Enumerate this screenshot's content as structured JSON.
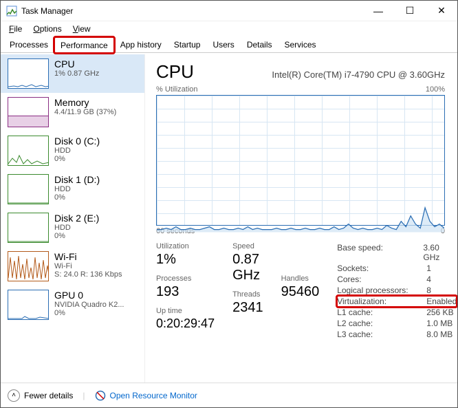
{
  "window": {
    "title": "Task Manager"
  },
  "menu": {
    "file": "File",
    "options": "Options",
    "view": "View"
  },
  "tabs": {
    "processes": "Processes",
    "performance": "Performance",
    "apphistory": "App history",
    "startup": "Startup",
    "users": "Users",
    "details": "Details",
    "services": "Services"
  },
  "sidebar": [
    {
      "title": "CPU",
      "sub1": "1%  0.87 GHz",
      "sub2": "",
      "color": "#2a6db3"
    },
    {
      "title": "Memory",
      "sub1": "4.4/11.9 GB (37%)",
      "sub2": "",
      "color": "#8a2d82"
    },
    {
      "title": "Disk 0 (C:)",
      "sub1": "HDD",
      "sub2": "0%",
      "color": "#3a8a2d"
    },
    {
      "title": "Disk 1 (D:)",
      "sub1": "HDD",
      "sub2": "0%",
      "color": "#3a8a2d"
    },
    {
      "title": "Disk 2 (E:)",
      "sub1": "HDD",
      "sub2": "0%",
      "color": "#3a8a2d"
    },
    {
      "title": "Wi-Fi",
      "sub1": "Wi-Fi",
      "sub2": "S: 24.0  R: 136 Kbps",
      "color": "#b35a1a"
    },
    {
      "title": "GPU 0",
      "sub1": "NVIDIA Quadro K2...",
      "sub2": "0%",
      "color": "#2a6db3"
    }
  ],
  "main": {
    "heading": "CPU",
    "model": "Intel(R) Core(TM) i7-4790 CPU @ 3.60GHz",
    "chart_top_left": "% Utilization",
    "chart_top_right": "100%",
    "chart_bot_left": "60 seconds",
    "chart_bot_right": "0",
    "stats": {
      "utilization_lbl": "Utilization",
      "utilization_val": "1%",
      "speed_lbl": "Speed",
      "speed_val": "0.87 GHz",
      "processes_lbl": "Processes",
      "processes_val": "193",
      "threads_lbl": "Threads",
      "threads_val": "2341",
      "handles_lbl": "Handles",
      "handles_val": "95460",
      "uptime_lbl": "Up time",
      "uptime_val": "0:20:29:47"
    },
    "right": {
      "base_speed_k": "Base speed:",
      "base_speed_v": "3.60 GHz",
      "sockets_k": "Sockets:",
      "sockets_v": "1",
      "cores_k": "Cores:",
      "cores_v": "4",
      "logical_k": "Logical processors:",
      "logical_v": "8",
      "virt_k": "Virtualization:",
      "virt_v": "Enabled",
      "l1_k": "L1 cache:",
      "l1_v": "256 KB",
      "l2_k": "L2 cache:",
      "l2_v": "1.0 MB",
      "l3_k": "L3 cache:",
      "l3_v": "8.0 MB"
    }
  },
  "footer": {
    "fewer": "Fewer details",
    "resmon": "Open Resource Monitor"
  },
  "chart_data": {
    "type": "line",
    "title": "% Utilization",
    "xlabel": "60 seconds",
    "ylabel": "",
    "ylim": [
      0,
      100
    ],
    "x": [
      0,
      1,
      2,
      3,
      4,
      5,
      6,
      7,
      8,
      9,
      10,
      11,
      12,
      13,
      14,
      15,
      16,
      17,
      18,
      19,
      20,
      21,
      22,
      23,
      24,
      25,
      26,
      27,
      28,
      29,
      30,
      31,
      32,
      33,
      34,
      35,
      36,
      37,
      38,
      39,
      40,
      41,
      42,
      43,
      44,
      45,
      46,
      47,
      48,
      49,
      50,
      51,
      52,
      53,
      54,
      55,
      56,
      57,
      58,
      59,
      60
    ],
    "values": [
      2,
      2,
      3,
      2,
      4,
      2,
      2,
      3,
      2,
      2,
      3,
      4,
      2,
      2,
      3,
      2,
      2,
      3,
      2,
      4,
      2,
      3,
      2,
      2,
      2,
      3,
      2,
      2,
      3,
      2,
      2,
      3,
      2,
      2,
      3,
      2,
      2,
      4,
      2,
      3,
      6,
      3,
      2,
      3,
      2,
      2,
      3,
      2,
      5,
      3,
      2,
      8,
      4,
      12,
      6,
      3,
      18,
      8,
      4,
      6,
      3
    ]
  }
}
